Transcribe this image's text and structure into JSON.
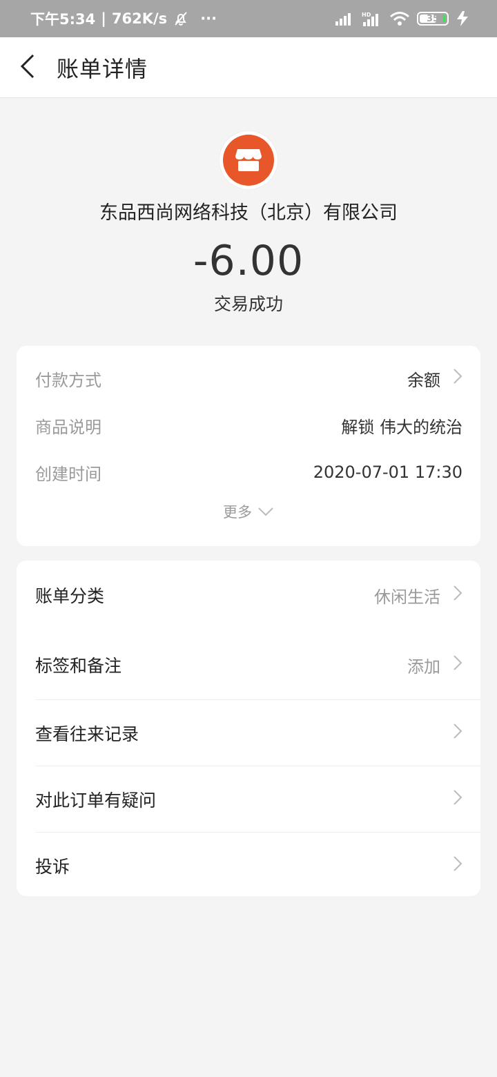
{
  "status_bar": {
    "time": "下午5:34",
    "speed": "762K/s",
    "more": "···",
    "battery": "35"
  },
  "header": {
    "title": "账单详情"
  },
  "merchant": {
    "name": "东品西尚网络科技（北京）有限公司",
    "amount": "-6.00",
    "status": "交易成功",
    "logo_color": "#e8572a"
  },
  "details": {
    "rows": [
      {
        "label": "付款方式",
        "value": "余额"
      },
      {
        "label": "商品说明",
        "value": "解锁 伟大的统治"
      },
      {
        "label": "创建时间",
        "value": "2020-07-01 17:30"
      }
    ],
    "more_label": "更多"
  },
  "menu": {
    "items": [
      {
        "label": "账单分类",
        "value": "休闲生活"
      },
      {
        "label": "标签和备注",
        "value": "添加"
      },
      {
        "label": "查看往来记录",
        "value": ""
      },
      {
        "label": "对此订单有疑问",
        "value": ""
      },
      {
        "label": "投诉",
        "value": ""
      }
    ]
  }
}
